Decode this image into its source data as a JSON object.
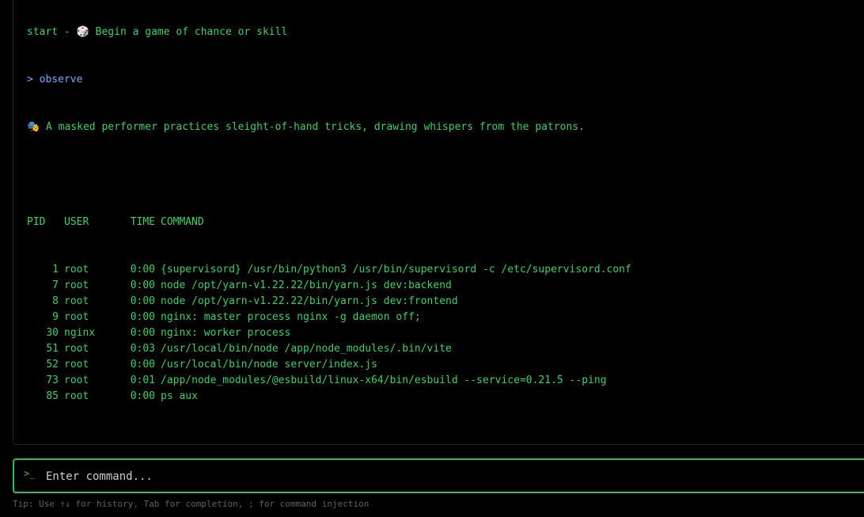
{
  "output": {
    "line_start": "start - ",
    "line_start_icon": "game-die-icon",
    "line_start_icon_glyph": "🎲",
    "line_start_text": " Begin a game of chance or skill",
    "echo_prompt": "> ",
    "echo_command": "observe",
    "observe_icon": "performing-arts-icon",
    "observe_icon_glyph": "🎭",
    "observe_text": " A masked performer practices sleight-of-hand tricks, drawing whispers from the patrons."
  },
  "ps": {
    "headers": {
      "pid": "PID",
      "user": "USER",
      "time": "TIME",
      "command": "COMMAND"
    },
    "rows": [
      {
        "pid": "1",
        "user": "root",
        "time": "0:00",
        "command": "{supervisord} /usr/bin/python3 /usr/bin/supervisord -c /etc/supervisord.conf"
      },
      {
        "pid": "7",
        "user": "root",
        "time": "0:00",
        "command": "node /opt/yarn-v1.22.22/bin/yarn.js dev:backend"
      },
      {
        "pid": "8",
        "user": "root",
        "time": "0:00",
        "command": "node /opt/yarn-v1.22.22/bin/yarn.js dev:frontend"
      },
      {
        "pid": "9",
        "user": "root",
        "time": "0:00",
        "command": "nginx: master process nginx -g daemon off;"
      },
      {
        "pid": "30",
        "user": "nginx",
        "time": "0:00",
        "command": "nginx: worker process"
      },
      {
        "pid": "51",
        "user": "root",
        "time": "0:03",
        "command": "/usr/local/bin/node /app/node_modules/.bin/vite"
      },
      {
        "pid": "52",
        "user": "root",
        "time": "0:00",
        "command": "/usr/local/bin/node server/index.js"
      },
      {
        "pid": "73",
        "user": "root",
        "time": "0:01",
        "command": "/app/node_modules/@esbuild/linux-x64/bin/esbuild --service=0.21.5 --ping"
      },
      {
        "pid": "85",
        "user": "root",
        "time": "0:00",
        "command": "ps aux"
      }
    ]
  },
  "input": {
    "prompt_glyph": ">_",
    "placeholder": "Enter command...",
    "value": ""
  },
  "tip": "Tip: Use ↑↓ for history, Tab for completion, ; for command injection",
  "colors": {
    "text_green": "#3fcf62",
    "echo_blue": "#7aa7ff",
    "border_green": "#2fbf56",
    "tip_gray": "#586658"
  }
}
